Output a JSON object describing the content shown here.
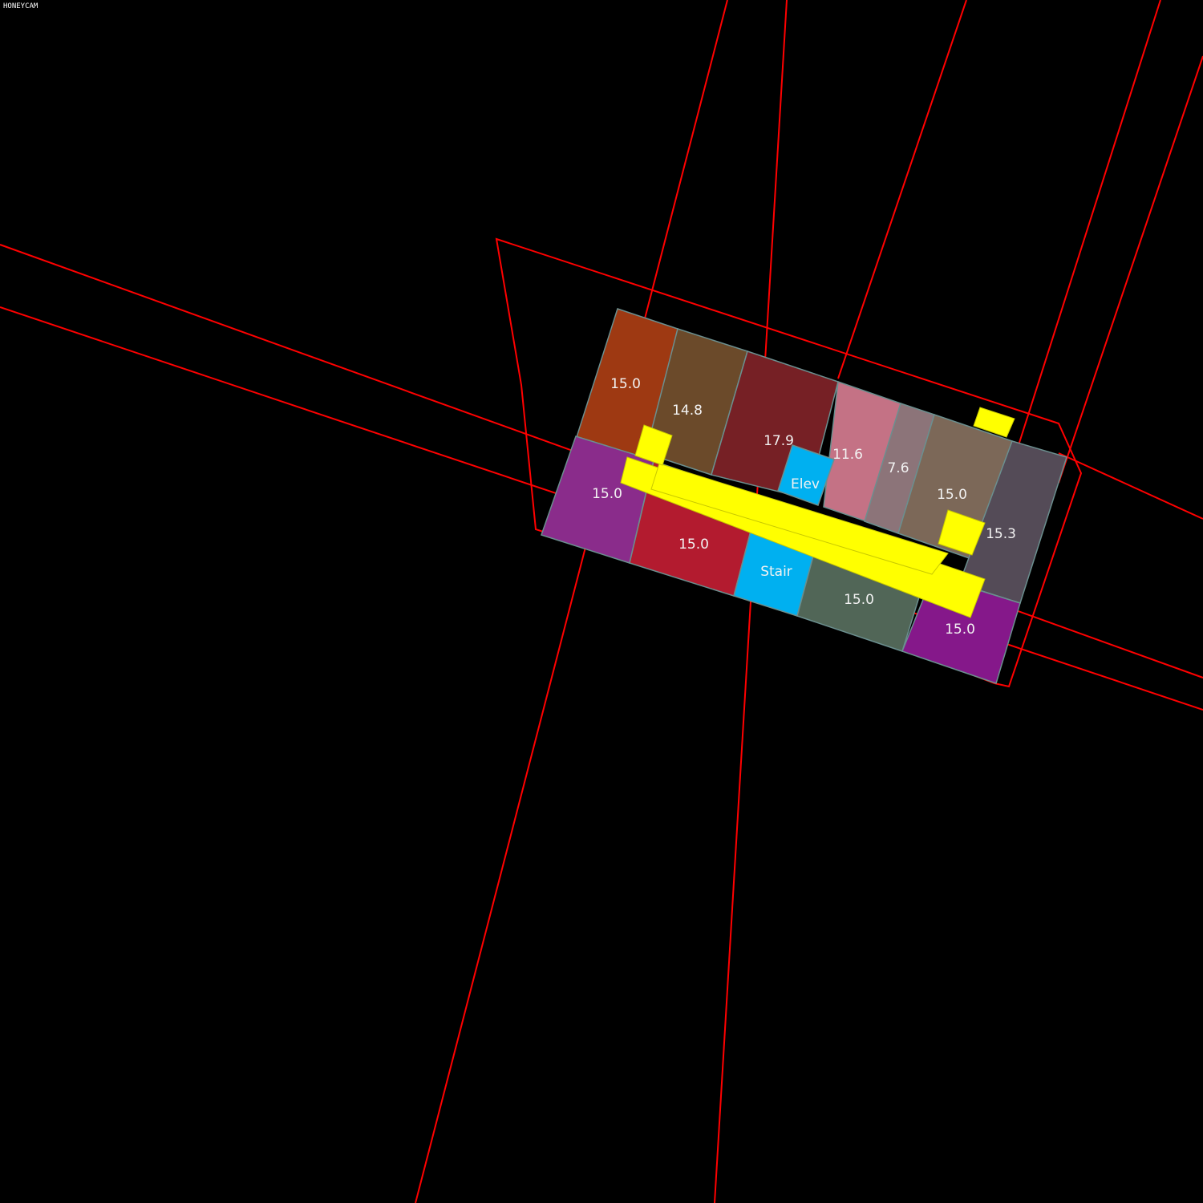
{
  "app": {
    "watermark": "HONEYCAM"
  },
  "colors": {
    "background": "#000000",
    "site_lines": "#ff0000",
    "corridor": "#ffff00",
    "core": "#00b0f0"
  },
  "rooms": [
    {
      "id": "r1",
      "label": "15.0",
      "color": "#9e3912"
    },
    {
      "id": "r2",
      "label": "14.8",
      "color": "#6b4a2a"
    },
    {
      "id": "r3",
      "label": "17.9",
      "color": "#762025"
    },
    {
      "id": "r4",
      "label": "11.6",
      "color": "#c47285"
    },
    {
      "id": "r5",
      "label": "7.6",
      "color": "#8c7479"
    },
    {
      "id": "r6",
      "label": "15.0",
      "color": "#7c6858"
    },
    {
      "id": "r7",
      "label": "15.3",
      "color": "#544b57"
    },
    {
      "id": "r8",
      "label": "15.0",
      "color": "#8a2c8b"
    },
    {
      "id": "r9",
      "label": "15.0",
      "color": "#b31b2f"
    },
    {
      "id": "r10",
      "label": "Stair",
      "color": "#00b0f0"
    },
    {
      "id": "r11",
      "label": "15.0",
      "color": "#516657"
    },
    {
      "id": "r12",
      "label": "15.0",
      "color": "#85188a"
    },
    {
      "id": "r13",
      "label": "Elev",
      "color": "#00b0f0"
    }
  ]
}
